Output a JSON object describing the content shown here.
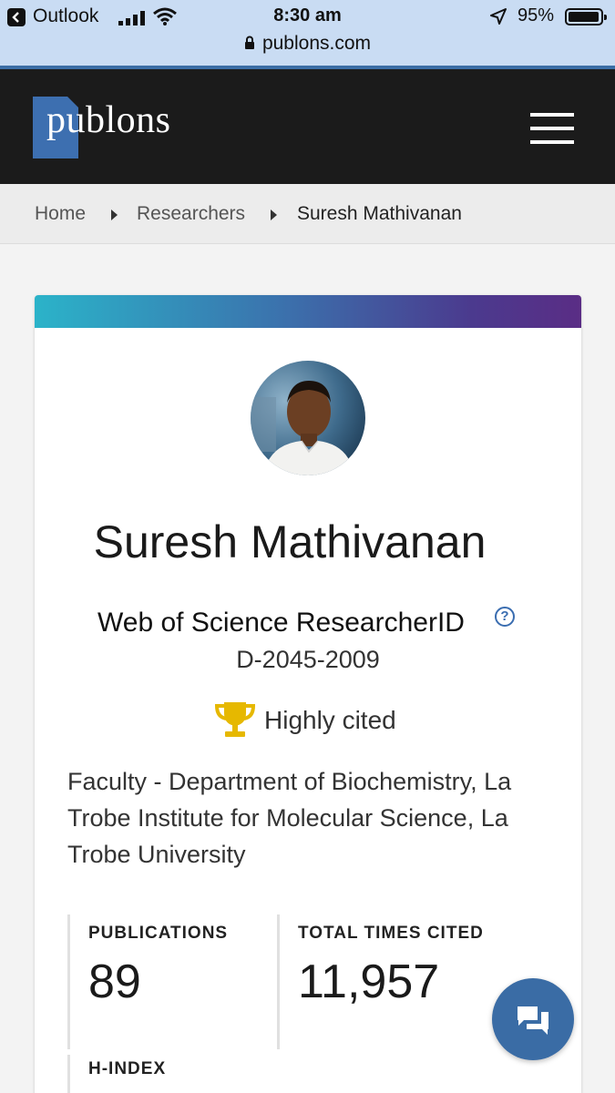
{
  "status_bar": {
    "back_app": "Outlook",
    "time": "8:30 am",
    "battery": "95%",
    "url": "publons.com",
    "icons": [
      "back-icon",
      "signal-icon",
      "wifi-icon",
      "location-icon",
      "battery-icon",
      "lock-icon"
    ]
  },
  "header": {
    "logo": "publons",
    "menu_icon": "hamburger-menu-icon"
  },
  "breadcrumb": {
    "items": [
      "Home",
      "Researchers",
      "Suresh Mathivanan"
    ]
  },
  "profile": {
    "name": "Suresh Mathivanan",
    "researcher_id_label": "Web of Science ResearcherID",
    "researcher_id_help": "?",
    "researcher_id": "D-2045-2009",
    "badge": "Highly cited",
    "affiliation": "Faculty - Department of Biochemistry, La Trobe Institute for Molecular Science, La Trobe University"
  },
  "stats": {
    "publications_label": "PUBLICATIONS",
    "publications": "89",
    "times_cited_label": "TOTAL TIMES CITED",
    "times_cited": "11,957",
    "h_index_label": "H-INDEX"
  },
  "colors": {
    "header_bg": "#1b1b1b",
    "brand_blue": "#3d6fb0",
    "band_start": "#2bb3c9",
    "band_end": "#5a2d85",
    "trophy": "#e6b800"
  }
}
